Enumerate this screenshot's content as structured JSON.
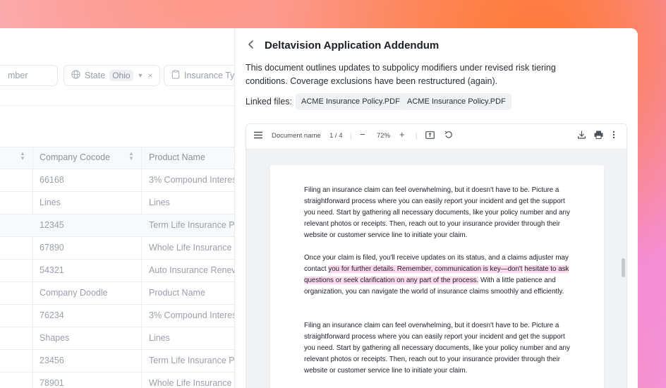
{
  "filters": {
    "number_placeholder": "mber",
    "state_label": "State",
    "state_value": "Ohio",
    "insurance_type_label": "Insurance Typ"
  },
  "table": {
    "headers": [
      "Company Cocode",
      "Product Name"
    ],
    "rows": [
      [
        "66168",
        "3% Compound Interest"
      ],
      [
        "Lines",
        "Lines"
      ],
      [
        "12345",
        "Term Life Insurance Po"
      ],
      [
        "67890",
        "Whole Life Insurance P"
      ],
      [
        "54321",
        "Auto Insurance Renewa"
      ],
      [
        "Company Doodle",
        "Product Name"
      ],
      [
        "76234",
        "3% Compound Interest"
      ],
      [
        "Shapes",
        "Lines"
      ],
      [
        "23456",
        "Term Life Insurance Po"
      ],
      [
        "78901",
        "Whole Life Insurance P"
      ]
    ]
  },
  "panel": {
    "title": "Deltavision Application Addendum",
    "description": "This document outlines updates to subpolicy modifiers under revised risk tiering conditions. Coverage exclusions have been restructured (again).",
    "linked_label": "Linked files:",
    "files": [
      "ACME Insurance Policy.PDF",
      "ACME Insurance Policy.PDF"
    ]
  },
  "viewer": {
    "doc_name": "Document name",
    "page_indicator": "1 / 4",
    "zoom": "72%",
    "paragraph1": "Filing an insurance claim can feel overwhelming, but it doesn't have to be. Picture a straightforward process where you can easily report your incident and get the support you need. Start by gathering all necessary documents, like your policy number and any relevant photos or receipts. Then, reach out to your insurance provider through their website or customer service line to initiate your claim.",
    "p2_before": "Once your claim is filed, you'll receive updates on its status, and a claims adjuster may contact ",
    "p2_highlight1": "you for further details. Remember, communication is key—don't",
    "p2_highlight2": "hesitate to ask questions or seek clarification on any part of the process.",
    "p2_after": " With a little patience and organization, you can navigate the world of insurance claims smoothly and efficiently.",
    "paragraph3": "Filing an insurance claim can feel overwhelming, but it doesn't have to be. Picture a straightforward process where you can easily report your incident and get the support you need. Start by gathering all necessary documents, like your policy number and any relevant photos or receipts. Then, reach out to your insurance provider through their website or customer service line to initiate your claim."
  }
}
